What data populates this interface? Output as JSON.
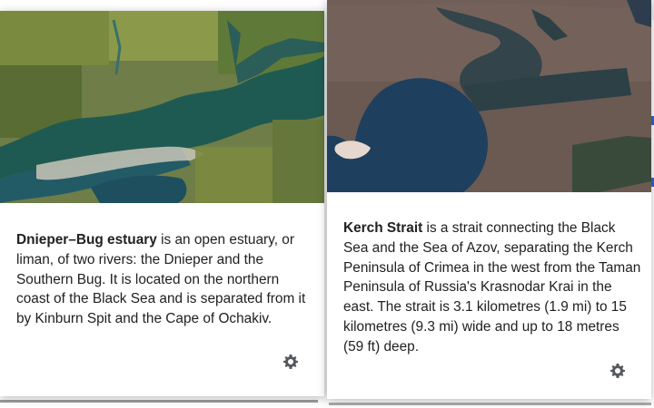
{
  "popups": [
    {
      "title_bold": "Dnieper–Bug estuary",
      "extract_rest": " is an open estuary, or liman, of two rivers: the Dnieper and the Southern Bug. It is located on the northern coast of the Black Sea and is separated from it by Kinburn Spit and the Cape of Ochakiv.",
      "thumbnail": "satellite-image-dnieper-bug-estuary",
      "settings_icon": "gear-icon"
    },
    {
      "title_bold": "Kerch Strait",
      "extract_rest": " is a strait connecting the Black Sea and the Sea of Azov, separating the Kerch Peninsula of Crimea in the west from the Taman Peninsula of Russia's Krasnodar Krai in the east. The strait is 3.1 kilometres (1.9 mi) to 15 kilometres (9.3 mi) wide and up to 18 metres (59 ft) deep.",
      "thumbnail": "satellite-image-kerch-strait",
      "settings_icon": "gear-icon"
    }
  ],
  "colors": {
    "text": "#202122",
    "link_accent": "#3366cc",
    "gear": "#54595d"
  }
}
